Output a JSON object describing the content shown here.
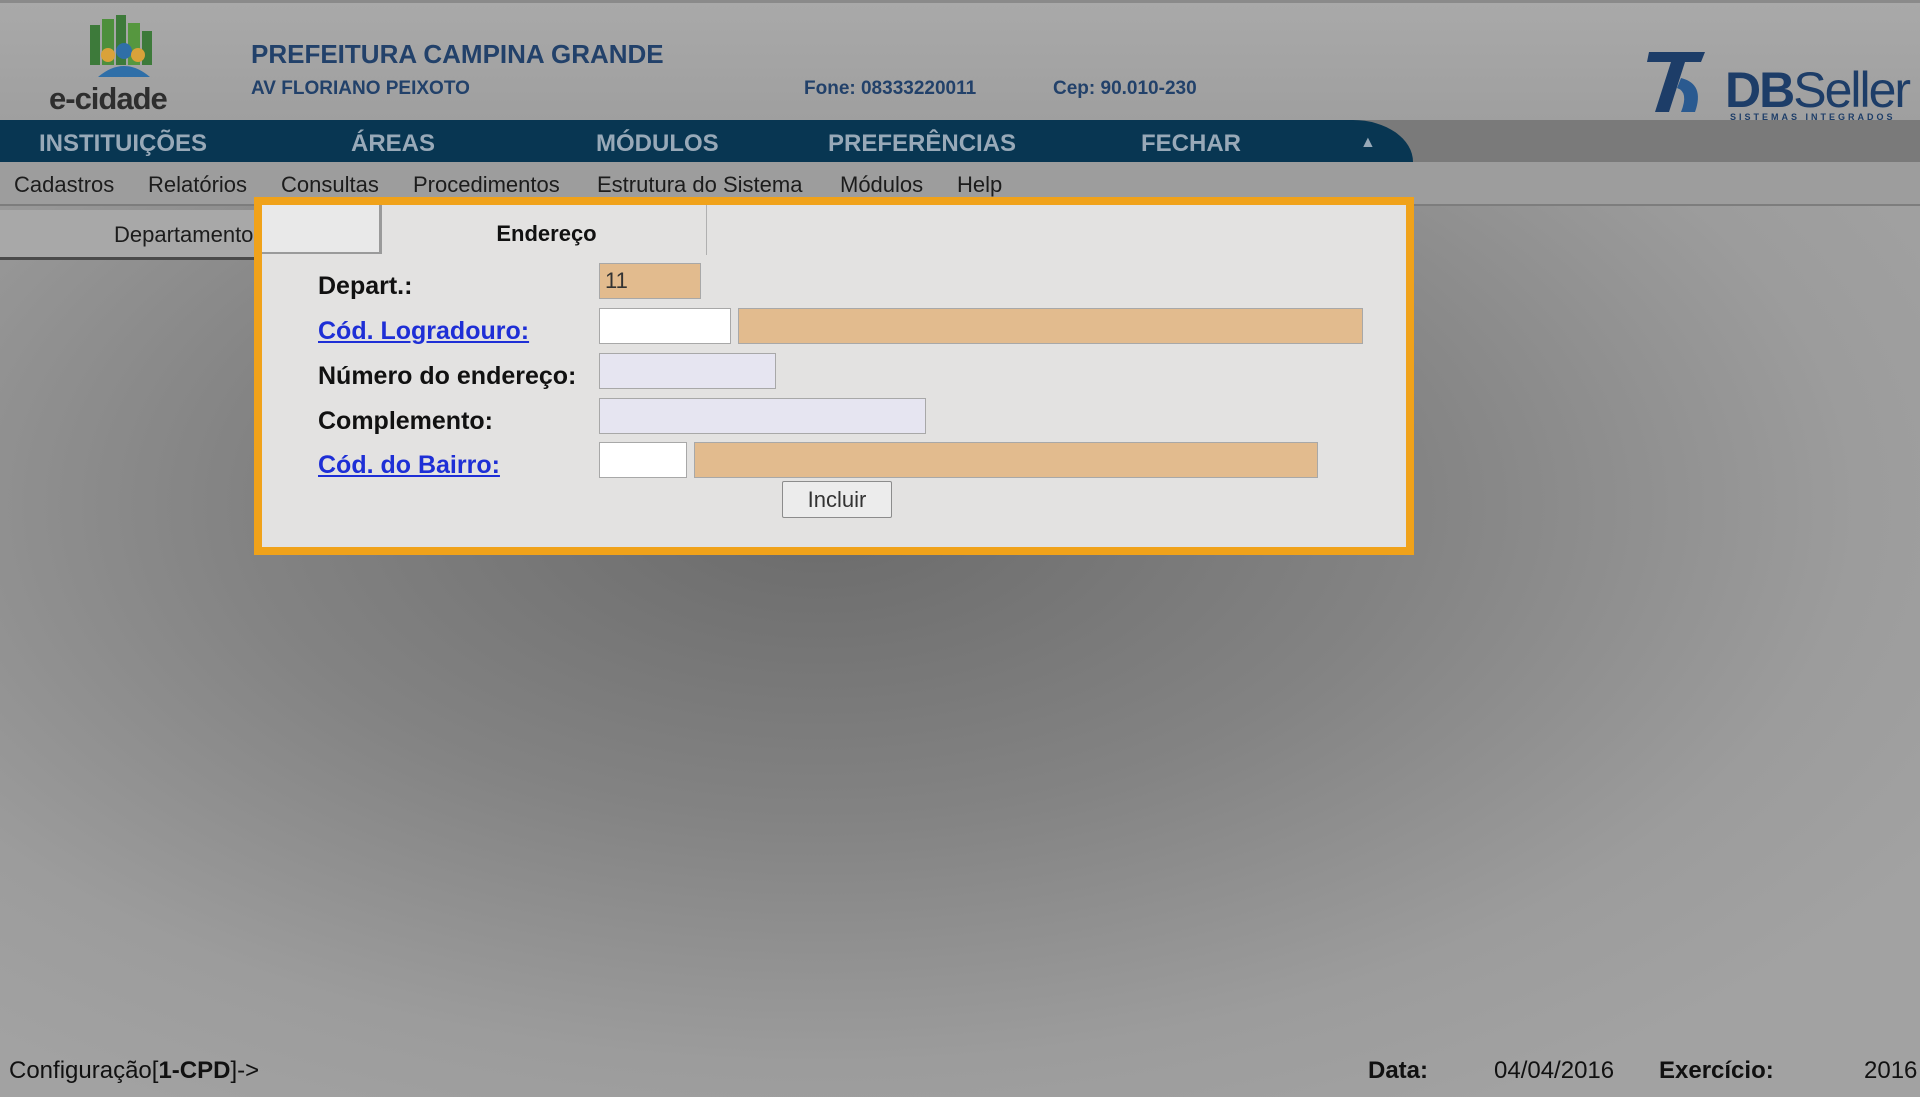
{
  "header": {
    "logo_text": "e-cidade",
    "institution_name": "PREFEITURA CAMPINA GRANDE",
    "address": "AV FLORIANO PEIXOTO",
    "phone": "Fone: 08333220011",
    "cep": "Cep: 90.010-230",
    "vendor_logo": {
      "bold": "DB",
      "regular": "Seller",
      "tagline": "SISTEMAS INTEGRADOS"
    }
  },
  "top_nav": {
    "items": [
      "INSTITUIÇÕES",
      "ÁREAS",
      "MÓDULOS",
      "PREFERÊNCIAS",
      "FECHAR"
    ],
    "collapse_icon": "▲"
  },
  "menu": {
    "items": [
      "Cadastros",
      "Relatórios",
      "Consultas",
      "Procedimentos",
      "Estrutura do Sistema",
      "Módulos",
      "Help"
    ]
  },
  "tabs": {
    "departamento": "Departamento",
    "endereco": "Endereço"
  },
  "form": {
    "depart_label": "Depart.:",
    "depart_value": "11",
    "logradouro_label": "Cód. Logradouro:",
    "logradouro_code": "",
    "logradouro_name": "",
    "numero_label": "Número do endereço:",
    "numero_value": "",
    "complemento_label": "Complemento:",
    "complemento_value": "",
    "bairro_label": "Cód. do Bairro:",
    "bairro_code": "",
    "bairro_name": "",
    "submit_label": "Incluir"
  },
  "footer": {
    "config_prefix": "Configuração[",
    "config_dept": "1-CPD",
    "config_suffix": "]->",
    "data_label": "Data:",
    "data_value": "04/04/2016",
    "exercicio_label": "Exercício:",
    "exercicio_value": "2016"
  },
  "colors": {
    "highlight_border": "#f0a21a",
    "nav_bg": "#083652",
    "link": "#1e2fd6",
    "readonly_field": "#e2bb8e"
  }
}
